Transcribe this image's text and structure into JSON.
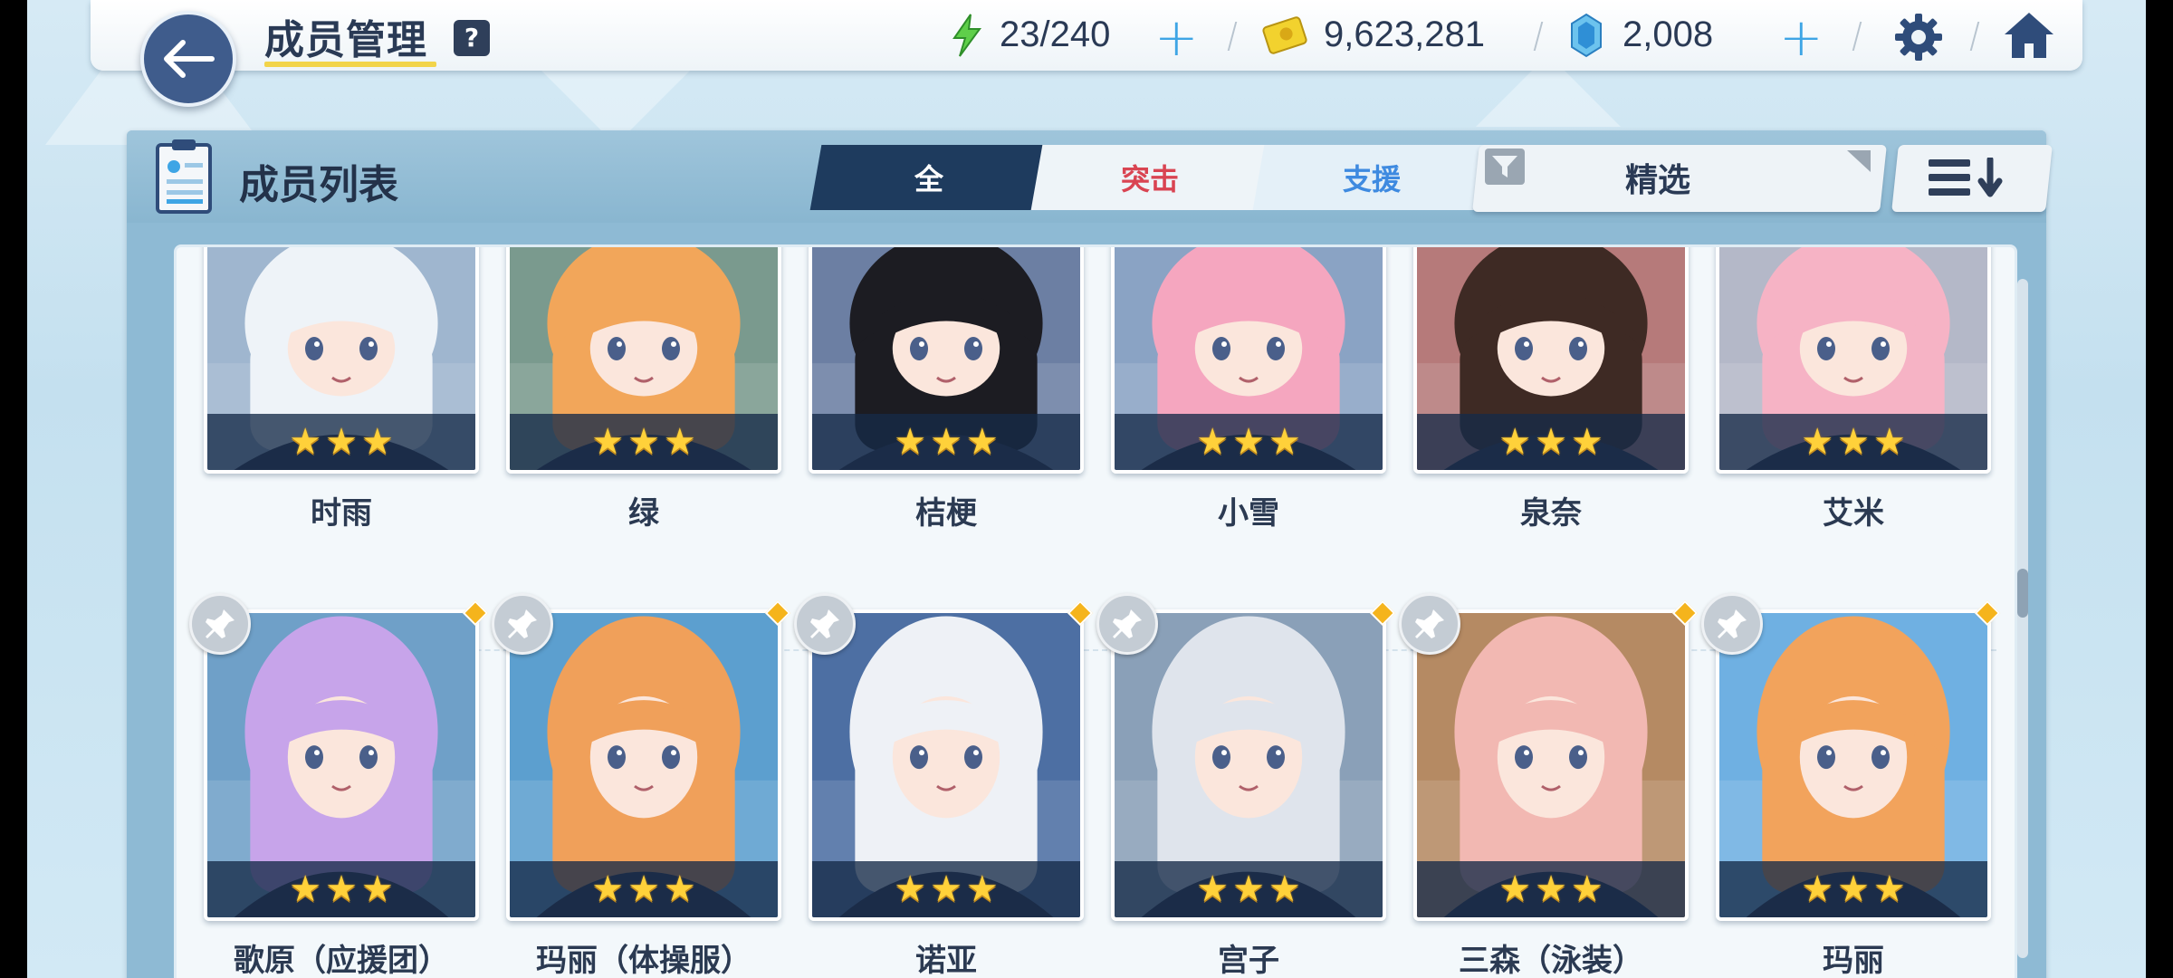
{
  "header": {
    "title": "成员管理",
    "help_label": "?",
    "energy": "23/240",
    "credits": "9,623,281",
    "gems": "2,008"
  },
  "panel": {
    "title": "成员列表",
    "tabs": [
      {
        "label": "全"
      },
      {
        "label": "突击"
      },
      {
        "label": "支援"
      }
    ],
    "filter_label": "精选"
  },
  "characters_row1": [
    {
      "name": "时雨",
      "stars": 3,
      "hair": "#eef3f8",
      "bg": "#9fb6cf"
    },
    {
      "name": "绿",
      "stars": 3,
      "hair": "#f2a65a",
      "bg": "#7a9a8e"
    },
    {
      "name": "桔梗",
      "stars": 3,
      "hair": "#1c1c22",
      "bg": "#6c7fa3"
    },
    {
      "name": "小雪",
      "stars": 3,
      "hair": "#f5a6bf",
      "bg": "#8aa3c4"
    },
    {
      "name": "泉奈",
      "stars": 3,
      "hair": "#3e2a24",
      "bg": "#b67a7a"
    },
    {
      "name": "艾米",
      "stars": 3,
      "hair": "#f6b3c5",
      "bg": "#b4b8c8"
    }
  ],
  "characters_row2": [
    {
      "name": "歌原（应援团）",
      "stars": 3,
      "hair": "#c7a4ea",
      "bg": "#6fa0c8"
    },
    {
      "name": "玛丽（体操服）",
      "stars": 3,
      "hair": "#f0a05a",
      "bg": "#5c9fcf"
    },
    {
      "name": "诺亚",
      "stars": 3,
      "hair": "#eef1f6",
      "bg": "#4d6fa3"
    },
    {
      "name": "宫子",
      "stars": 3,
      "hair": "#dfe4ec",
      "bg": "#8aa0b8"
    },
    {
      "name": "三森（泳装）",
      "stars": 3,
      "hair": "#f2b8b2",
      "bg": "#b58a63"
    },
    {
      "name": "玛丽",
      "stars": 3,
      "hair": "#f2a35c",
      "bg": "#6fb0e2"
    }
  ]
}
